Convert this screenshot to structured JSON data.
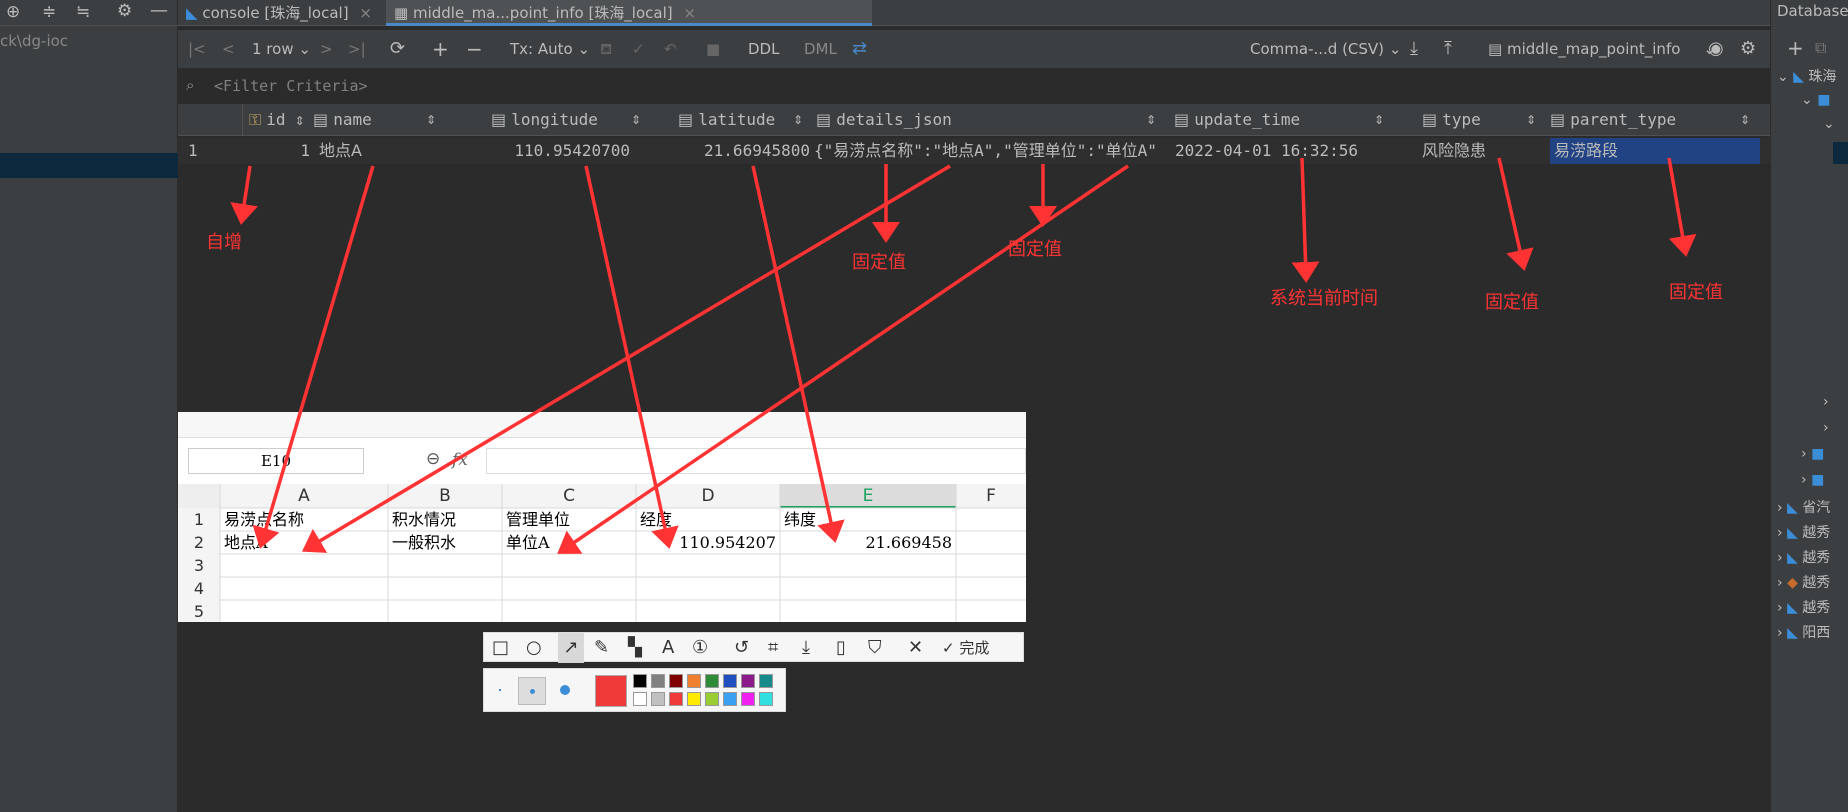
{
  "left_panel": {
    "path_fragment": "ck\\dg-ioc"
  },
  "tabs": [
    {
      "label": "console [珠海_local]",
      "active": false
    },
    {
      "label": "middle_ma...point_info [珠海_local]",
      "active": true
    }
  ],
  "right_panel": {
    "title": "Database",
    "tree_labels": [
      "珠海",
      "省汽",
      "越秀",
      "越秀",
      "越秀",
      "越秀",
      "阳西"
    ]
  },
  "toolbar": {
    "rows_label": "1 row",
    "tx_label": "Tx: Auto",
    "ddl_label": "DDL",
    "dml_label": "DML",
    "export_format": "Comma-...d (CSV)",
    "table_name": "middle_map_point_info"
  },
  "filter": {
    "placeholder": "<Filter Criteria>"
  },
  "grid": {
    "columns": [
      "id",
      "name",
      "longitude",
      "latitude",
      "details_json",
      "update_time",
      "type",
      "parent_type"
    ],
    "row_number": "1",
    "row": {
      "id": "1",
      "name": "地点A",
      "longitude": "110.95420700",
      "latitude": "21.66945800",
      "details_json": "{\"易涝点名称\":\"地点A\",\"管理单位\":\"单位A\"",
      "update_time": "2022-04-01 16:32:56",
      "type": "风险隐患",
      "parent_type": "易涝路段"
    }
  },
  "annotations": {
    "id_note": "自增",
    "details_note_1": "固定值",
    "details_note_2": "固定值",
    "update_time_note": "系统当前时间",
    "type_note": "固定值",
    "parent_type_note": "固定值"
  },
  "spreadsheet": {
    "name_box": "E10",
    "fx_label": "fx",
    "col_headers": [
      "A",
      "B",
      "C",
      "D",
      "E",
      "F"
    ],
    "row_headers": [
      "1",
      "2",
      "3",
      "4",
      "5"
    ],
    "header_row": [
      "易涝点名称",
      "积水情况",
      "管理单位",
      "经度",
      "纬度",
      ""
    ],
    "data_row": [
      "地点A",
      "一般积水",
      "单位A",
      "110.954207",
      "21.669458",
      ""
    ]
  },
  "snip_toolbar": {
    "done_label": "完成"
  },
  "colors": {
    "accent": "#ff3333",
    "selection": "#214283",
    "sheet_active_col": "#1aa260"
  }
}
